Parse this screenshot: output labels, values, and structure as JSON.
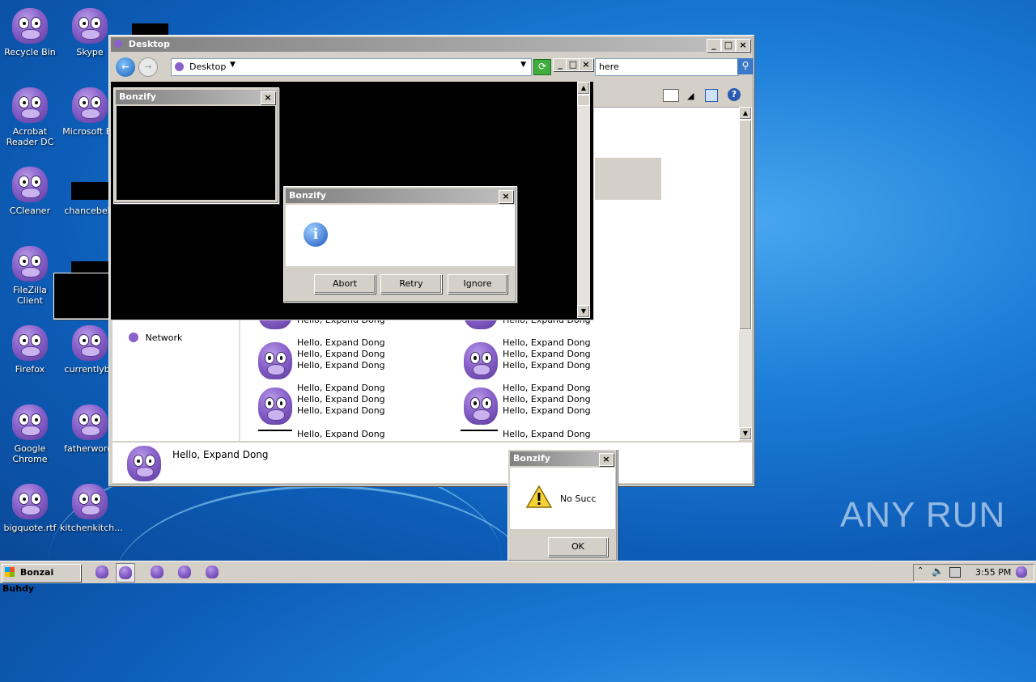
{
  "desktop": {
    "icons": [
      {
        "label": "Recycle Bin"
      },
      {
        "label": "Skype"
      },
      {
        "label": "Acrobat Reader DC"
      },
      {
        "label": "Microsoft Ed"
      },
      {
        "label": "CCleaner"
      },
      {
        "label": "chancebehi"
      },
      {
        "label": "FileZilla Client"
      },
      {
        "label": "Firefox"
      },
      {
        "label": "currentlybo"
      },
      {
        "label": "Google Chrome"
      },
      {
        "label": "fatherword."
      },
      {
        "label": "bigquote.rtf"
      },
      {
        "label": "kitchenkitch..."
      }
    ]
  },
  "explorer": {
    "title": "Desktop",
    "address": "Desktop",
    "search_text": "here",
    "nav_network": "Network",
    "item_text": "Hello, Expand Dong",
    "details_text": "Hello, Expand Dong"
  },
  "bonzify_small": {
    "title": "Bonzify"
  },
  "bonzify_dialog": {
    "title": "Bonzify",
    "buttons": {
      "abort": "Abort",
      "retry": "Retry",
      "ignore": "Ignore"
    }
  },
  "bonzify_warning": {
    "title": "Bonzify",
    "message": "No Succ",
    "ok": "OK"
  },
  "taskbar": {
    "start_label": "Bonzai Buhdy",
    "clock": "3:55 PM"
  },
  "watermark": {
    "text": "ANY RUN"
  },
  "colors": {
    "titlebar": "#808080",
    "face": "#d4d0c8",
    "desktop": "#1d7fd8"
  }
}
